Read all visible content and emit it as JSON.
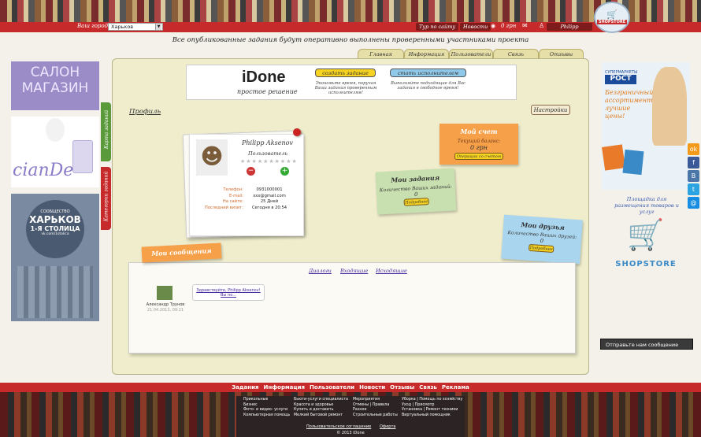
{
  "topbar": {
    "city_label": "Ваш город",
    "city_value": "Харьков",
    "nav": [
      "Тур по сайту",
      "Новости"
    ],
    "balance": "0 грн",
    "user": "Philipp"
  },
  "brand": {
    "logo_text": "SHOPSTORE"
  },
  "announcement": "Все опубликованные задания будут оперативно выполнены проверенными участниками проекта",
  "tabs": [
    "Главная",
    "Информация",
    "Пользователи",
    "Связь",
    "Отзывы"
  ],
  "promo": {
    "title": "iDone",
    "subtitle": "простое решение",
    "create_button": "создать задание",
    "create_text": "Экономьте время, поручая Ваши задания проверенным исполнителям!",
    "performer_button": "стать исполнителем",
    "performer_text": "Выполняйте подходящие для Вас задания в свободное время!"
  },
  "profile": {
    "link": "Профиль",
    "settings_button": "Настройки",
    "name": "Philipp Aksenov",
    "role": "Пользователь",
    "fields": [
      {
        "label": "Телефон:",
        "value": "0931000001"
      },
      {
        "label": "E-mail:",
        "value": "xxx@gmail.com"
      },
      {
        "label": "На сайте:",
        "value": "25 Дней"
      },
      {
        "label": "Последний визит:",
        "value": "Сегодня в 20:54"
      }
    ]
  },
  "account": {
    "title": "Мой счет",
    "balance_label": "Текущий баланс:",
    "balance_value": "0 грн",
    "ops_button": "Операции со счетом"
  },
  "tasks": {
    "title": "Мои задания",
    "count_label": "Количество Ваших заданий:",
    "count": "0",
    "details_button": "Подробнее"
  },
  "friends": {
    "title": "Мои друзья",
    "count_label": "Количество Ваших друзей:",
    "count": "0",
    "details_button": "Подробнее"
  },
  "messages": {
    "title": "Мои сообщения",
    "tabs": [
      "Диалоги",
      "Входящие",
      "Исходящие"
    ],
    "items": [
      {
        "author": "Александр Трунов",
        "date": "21.04.2013, 09:21",
        "text": "Здравствуйте, Philipp Aksenov! Вы по..."
      }
    ]
  },
  "side_tabs": {
    "map": "Карта заданий",
    "categories": "Категории заданий"
  },
  "left_banners": {
    "salon_lines": [
      "САЛОН",
      "МАГАЗИН"
    ],
    "brand": "cianDe",
    "kharkov": [
      "СООБЩЕСТВО",
      "ХАРЬКОВ",
      "1-Я СТОЛИЦА",
      "vk.com/1stolica"
    ]
  },
  "right_banners": {
    "rost": "РОСТ",
    "rost_top": "СУПЕРМАРКЕТЫ",
    "rost_slogan": "Безграничный ассортимент, лучшие цены!",
    "ad_place": "Площадка для размещения товаров и услуг",
    "shopstore": "SHOPSTORE"
  },
  "feedback_button": "Отправьте нам сообщение",
  "social": [
    "ok",
    "f",
    "B",
    "t",
    "@"
  ],
  "footer": {
    "nav": [
      "Задания",
      "Информация",
      "Пользователи",
      "Новости",
      "Отзывы",
      "Связь",
      "Реклама"
    ],
    "col1": [
      "Прикольные",
      "Бизнес",
      "Фото- и видео- услуги",
      "Компьютерная помощь"
    ],
    "col2": [
      "Бьюти-услуги специалиста",
      "Красота и здоровье",
      "Купить и доставить",
      "Мелкий бытовой ремонт"
    ],
    "col3": [
      "Мероприятия",
      "Отмены | Правила",
      "Разное",
      "Строительные работы"
    ],
    "col4": [
      "Уборка | Помощь по хозяйству",
      "Уход | Присмотр",
      "Установка | Ремонт техники",
      "Виртуальный помощник"
    ],
    "agreement": "Пользовательское соглашение",
    "offer": "Оферта",
    "copyright": "© 2013 iDone"
  },
  "colors": {
    "brand_red": "#c62a2a",
    "note_orange": "#f7a04a",
    "note_green": "#c8e0b0",
    "note_blue": "#a9d6ee"
  }
}
